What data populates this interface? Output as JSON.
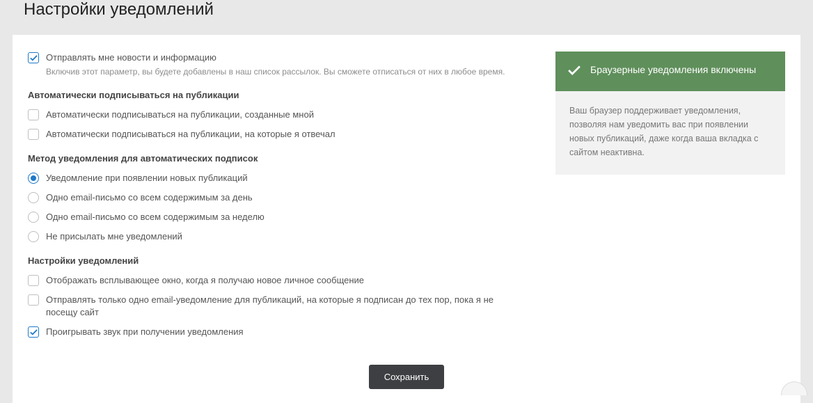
{
  "page_title": "Настройки уведомлений",
  "news": {
    "label": "Отправлять мне новости и информацию",
    "desc": "Включив этот параметр, вы будете добавлены в наш список рассылок. Вы сможете отписаться от них в любое время.",
    "checked": true
  },
  "auto_sub": {
    "title": "Автоматически подписываться на публикации",
    "opts": [
      {
        "label": "Автоматически подписываться на публикации, созданные мной",
        "checked": false
      },
      {
        "label": "Автоматически подписываться на публикации, на которые я отвечал",
        "checked": false
      }
    ]
  },
  "method": {
    "title": "Метод уведомления для автоматических подписок",
    "opts": [
      {
        "label": "Уведомление при появлении новых публикаций",
        "checked": true
      },
      {
        "label": "Одно email-письмо со всем содержимым за день",
        "checked": false
      },
      {
        "label": "Одно email-письмо со всем содержимым за неделю",
        "checked": false
      },
      {
        "label": "Не присылать мне уведомлений",
        "checked": false
      }
    ]
  },
  "notif_settings": {
    "title": "Настройки уведомлений",
    "opts": [
      {
        "label": "Отображать всплывающее окно, когда я получаю новое личное сообщение",
        "checked": false
      },
      {
        "label": "Отправлять только одно email-уведомление для публикаций, на которые я подписан до тех пор, пока я не посещу сайт",
        "checked": false
      },
      {
        "label": "Проигрывать звук при получении уведомления",
        "checked": true
      }
    ]
  },
  "sidebar": {
    "banner_title": "Браузерные уведомления включены",
    "info": "Ваш браузер поддерживает уведомления, позволяя нам уведомить вас при появлении новых публикаций, даже когда ваша вкладка с сайтом неактивна."
  },
  "save_label": "Сохранить"
}
